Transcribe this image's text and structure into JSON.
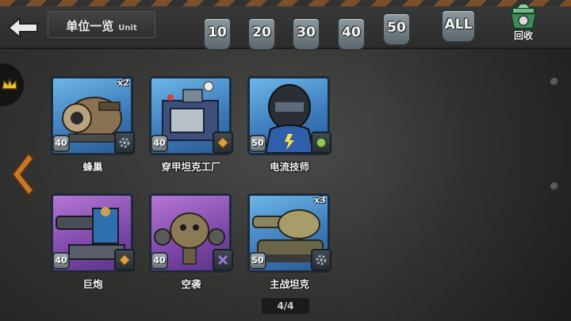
{
  "header": {
    "title": "单位一览",
    "title_en": "Unit",
    "back_icon": "back-arrow-icon"
  },
  "level_tabs": [
    {
      "label": "10"
    },
    {
      "label": "20"
    },
    {
      "label": "30"
    },
    {
      "label": "40"
    },
    {
      "label": "50"
    },
    {
      "label": "ALL"
    }
  ],
  "recycle": {
    "label": "回收",
    "icon": "recycle-bin-icon"
  },
  "units": [
    {
      "name": "蜂巢",
      "level": "40",
      "count": "x2",
      "frame": "blue",
      "type_icon": "gear-icon"
    },
    {
      "name": "穿甲坦克工厂",
      "level": "40",
      "count": "",
      "frame": "blue",
      "type_icon": "diamond-icon"
    },
    {
      "name": "电流技师",
      "level": "50",
      "count": "",
      "frame": "blue",
      "type_icon": "orb-icon"
    },
    {
      "name": "巨炮",
      "level": "40",
      "count": "",
      "frame": "purple",
      "type_icon": "diamond-icon"
    },
    {
      "name": "空袭",
      "level": "40",
      "count": "",
      "frame": "purple",
      "type_icon": "crossed-icon"
    },
    {
      "name": "主战坦克",
      "level": "50",
      "count": "x3",
      "frame": "blue",
      "type_icon": "gear-icon"
    }
  ],
  "pagination": {
    "text": "4/4"
  },
  "colors": {
    "accent_orange": "#c9782a",
    "frame_blue": "#4a8ccc",
    "frame_purple": "#8a52b4"
  }
}
